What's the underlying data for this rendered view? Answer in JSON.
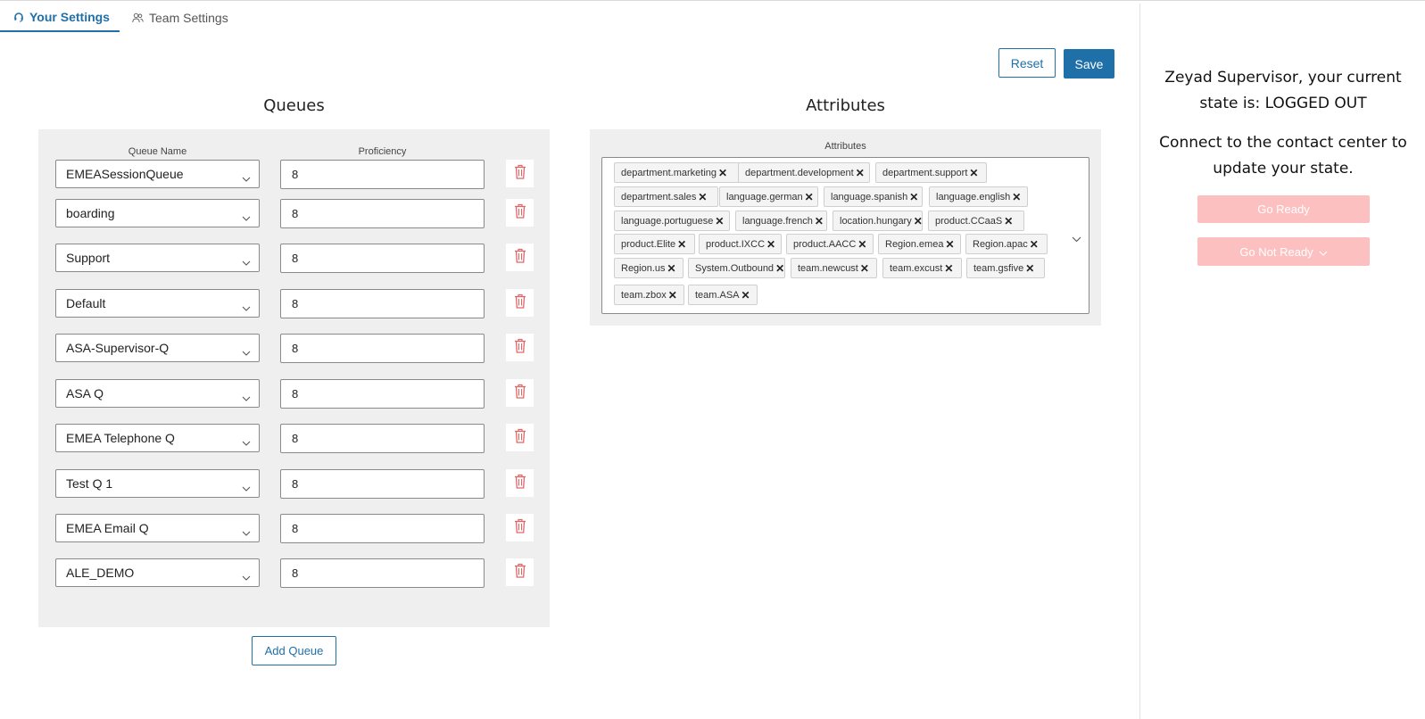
{
  "tabs": [
    {
      "label": "Your Settings",
      "icon": "headset-icon",
      "active": true
    },
    {
      "label": "Team Settings",
      "icon": "team-icon",
      "active": false
    }
  ],
  "toolbar": {
    "reset_label": "Reset",
    "save_label": "Save"
  },
  "queues": {
    "title": "Queues",
    "col_queue_name": "Queue Name",
    "col_proficiency": "Proficiency",
    "rows": [
      {
        "name": "EMEASessionQueue",
        "proficiency": "8"
      },
      {
        "name": "boarding",
        "proficiency": "8"
      },
      {
        "name": "Support",
        "proficiency": "8"
      },
      {
        "name": "Default",
        "proficiency": "8"
      },
      {
        "name": "ASA-Supervisor-Q",
        "proficiency": "8"
      },
      {
        "name": "ASA Q",
        "proficiency": "8"
      },
      {
        "name": "EMEA Telephone Q",
        "proficiency": "8"
      },
      {
        "name": "Test Q 1",
        "proficiency": "8"
      },
      {
        "name": "EMEA Email Q",
        "proficiency": "8"
      },
      {
        "name": "ALE_DEMO",
        "proficiency": "8"
      }
    ],
    "add_label": "Add Queue"
  },
  "attributes": {
    "title": "Attributes",
    "field_label": "Attributes",
    "chips": [
      "department.marketing",
      "department.development",
      "department.support",
      "department.sales",
      "language.german",
      "language.spanish",
      "language.english",
      "language.portuguese",
      "language.french",
      "location.hungary",
      "product.CCaaS",
      "product.Elite",
      "product.IXCC",
      "product.AACC",
      "Region.emea",
      "Region.apac",
      "Region.us",
      "System.Outbound",
      "team.newcust",
      "team.excust",
      "team.gsfive",
      "team.zbox",
      "team.ASA"
    ]
  },
  "agent_state": {
    "message": "Zeyad Supervisor, your current state is: LOGGED OUT",
    "connect_message": "Connect to the contact center to update your state.",
    "go_ready_label": "Go Ready",
    "go_not_ready_label": "Go Not Ready"
  },
  "colors": {
    "accent": "#1f6fa8",
    "delete": "#e06666",
    "disabled_button": "#fdc0c0",
    "panel_bg": "#efefef"
  }
}
